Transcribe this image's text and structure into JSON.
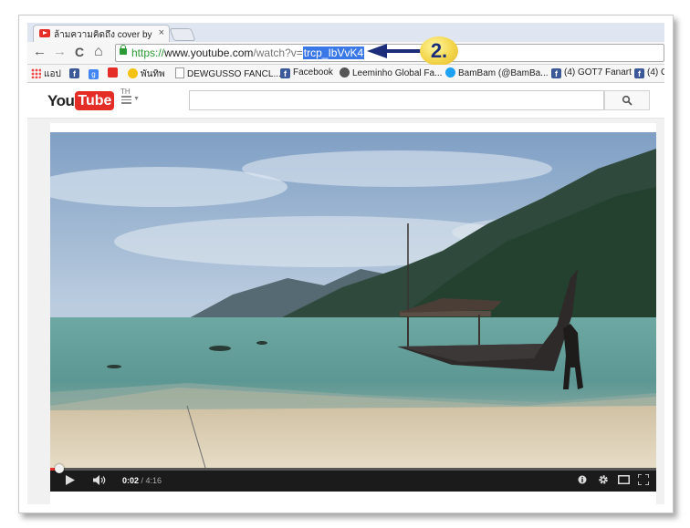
{
  "browser": {
    "tab": {
      "title": "ล้ามความคิดถึง cover by de",
      "close": "×"
    },
    "nav": {
      "back": "←",
      "forward": "→",
      "reload": "C",
      "home": "⌂"
    },
    "address": {
      "protocol": "https://",
      "host": "www.youtube.com",
      "path": "/watch?v=",
      "selected": "trcp_IbVvK4"
    },
    "annotation": {
      "step_label": "2."
    },
    "bookmarks": [
      {
        "label": "แอป",
        "icon": "apps-icon"
      },
      {
        "label": "",
        "icon": "facebook-icon"
      },
      {
        "label": "",
        "icon": "google-plus-icon"
      },
      {
        "label": "",
        "icon": "youtube-icon"
      },
      {
        "label": "พันทิพ",
        "icon": "pantip-icon"
      },
      {
        "label": "DEWGUSSO FANCL...",
        "icon": "page-icon"
      },
      {
        "label": "Facebook",
        "icon": "facebook-icon"
      },
      {
        "label": "Leeminho Global Fa...",
        "icon": "wordpress-icon"
      },
      {
        "label": "BamBam (@BamBa...",
        "icon": "twitter-icon"
      },
      {
        "label": "(4) GOT7 Fanart",
        "icon": "facebook-icon"
      },
      {
        "label": "(4) G",
        "icon": "facebook-icon"
      }
    ]
  },
  "youtube": {
    "logo": {
      "you": "You",
      "tube": "Tube",
      "country": "TH"
    },
    "search": {
      "placeholder": ""
    },
    "player": {
      "current_time": "0:02",
      "separator": " / ",
      "duration": "4:16",
      "progress": 0.008
    }
  },
  "colors": {
    "youtube_red": "#e52d27",
    "selection_blue": "#3b78e7",
    "secure_green": "#2d9a35",
    "annotation_arrow": "#1c2d7a",
    "badge_yellow": "#f3d54a"
  }
}
